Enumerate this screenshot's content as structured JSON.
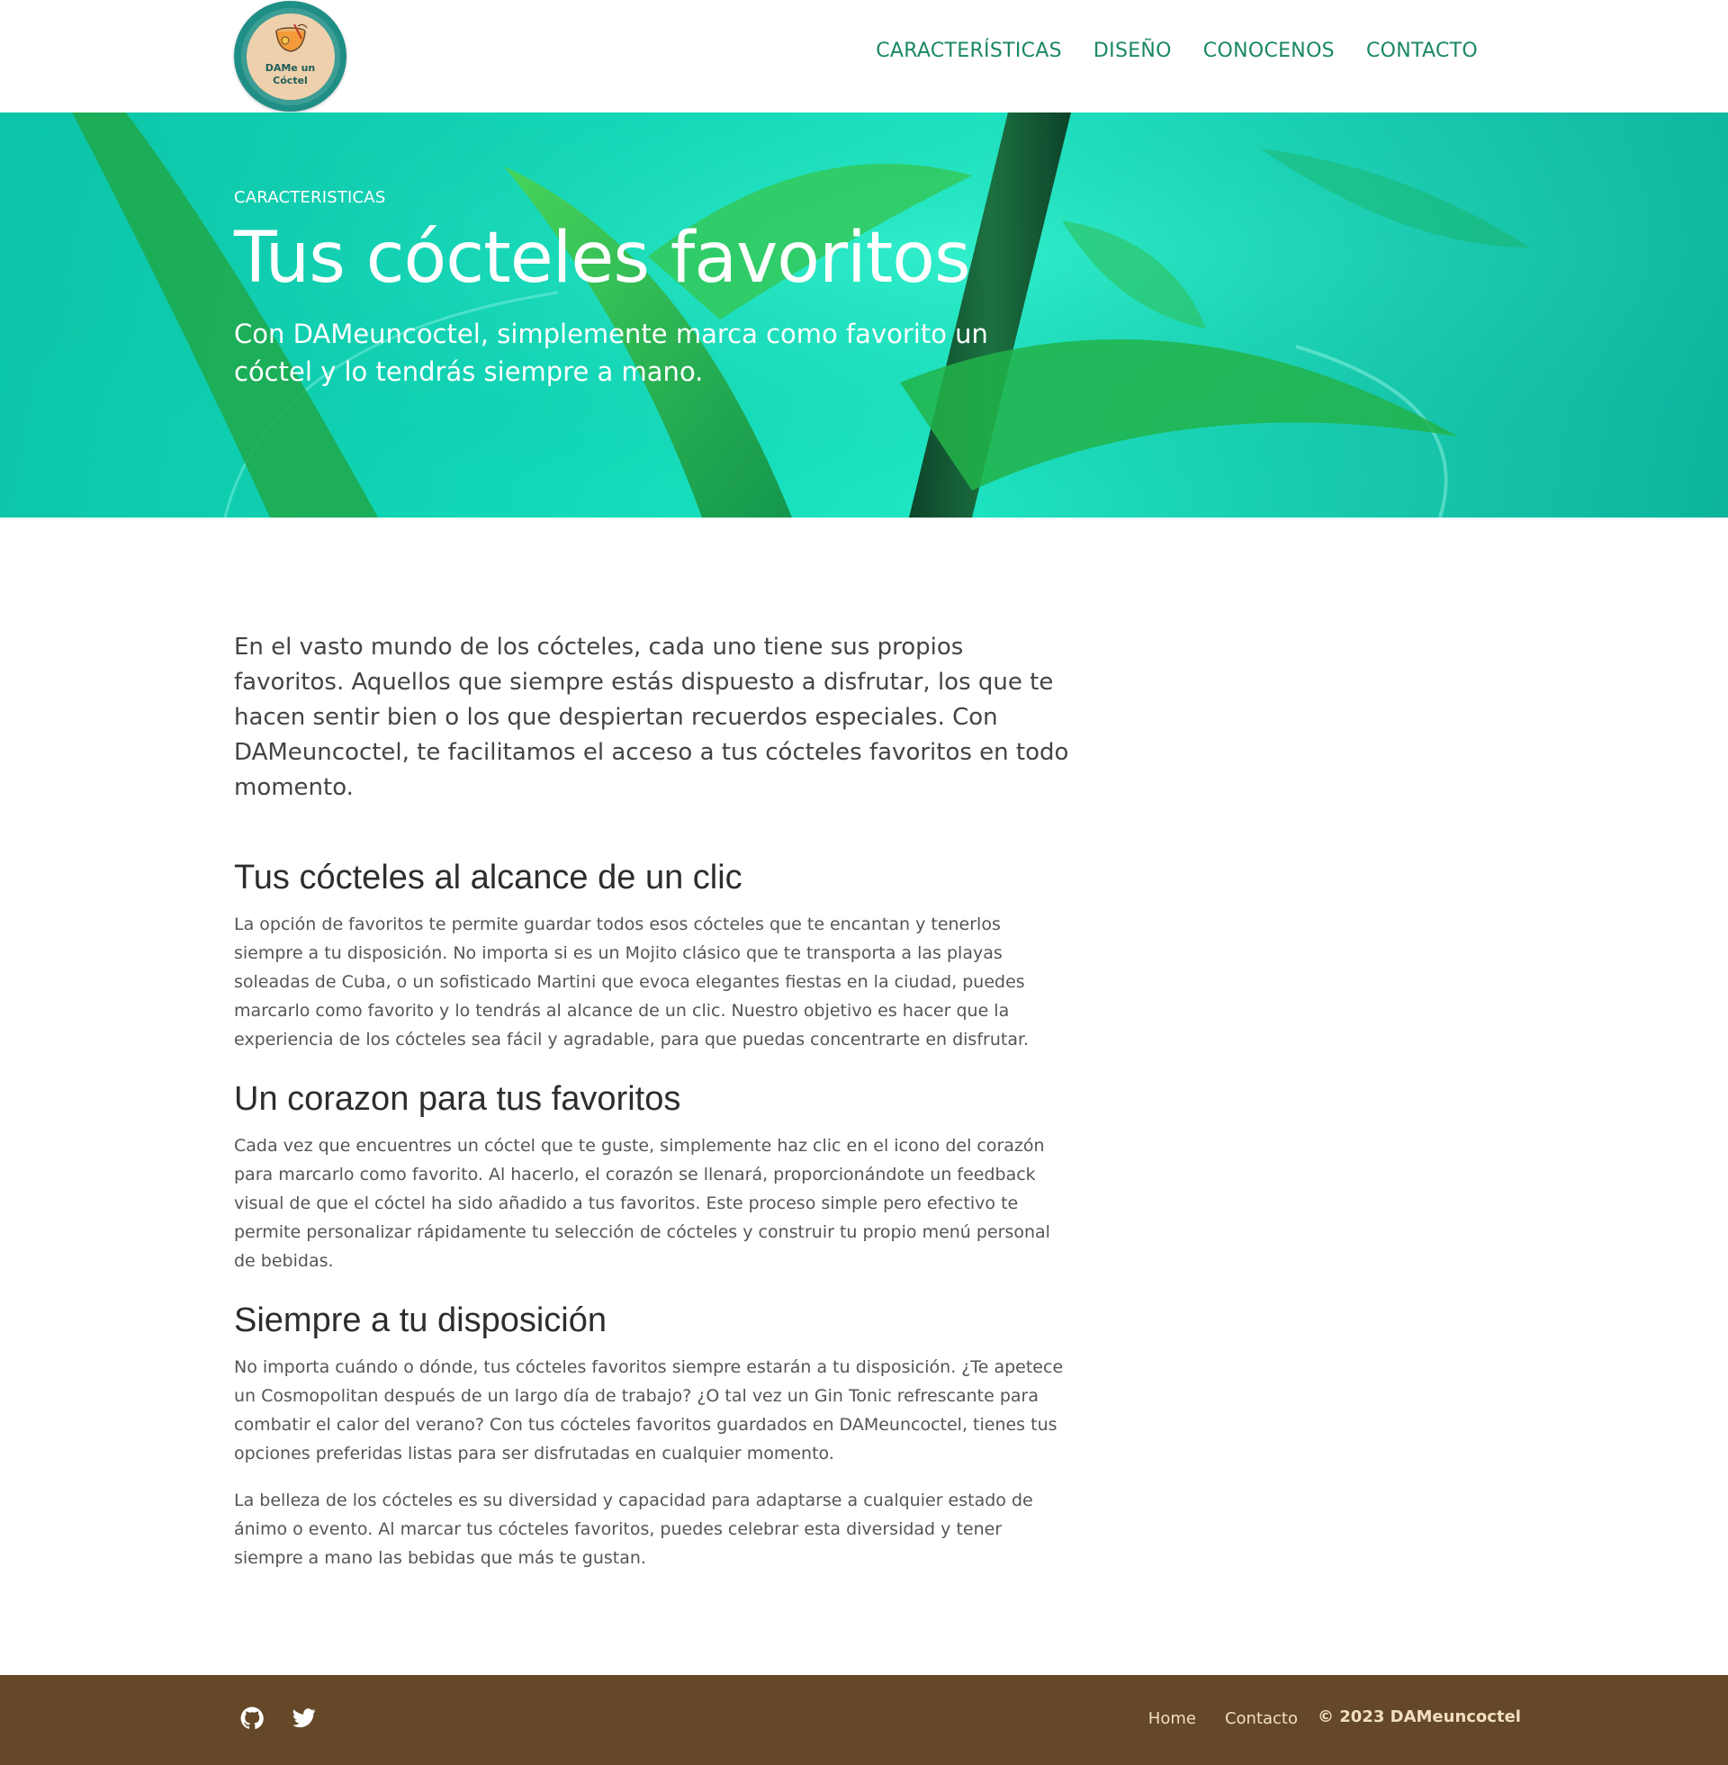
{
  "header": {
    "logo_text": "DAMe un Cóctel",
    "nav": [
      {
        "label": "CARACTERÍSTICAS"
      },
      {
        "label": "DISEÑO"
      },
      {
        "label": "CONOCENOS"
      },
      {
        "label": "CONTACTO"
      }
    ]
  },
  "hero": {
    "kicker": "CARACTERISTICAS",
    "title": "Tus cócteles favoritos",
    "subtitle": "Con DAMeuncoctel, simplemente marca como favorito un cóctel y lo tendrás siempre a mano."
  },
  "article": {
    "lead": "En el vasto mundo de los cócteles, cada uno tiene sus propios favoritos. Aquellos que siempre estás dispuesto a disfrutar, los que te hacen sentir bien o los que despiertan recuerdos especiales. Con DAMeuncoctel, te facilitamos el acceso a tus cócteles favoritos en todo momento.",
    "sections": [
      {
        "title": "Tus cócteles al alcance de un clic",
        "paragraphs": [
          "La opción de favoritos te permite guardar todos esos cócteles que te encantan y tenerlos siempre a tu disposición. No importa si es un Mojito clásico que te transporta a las playas soleadas de Cuba, o un sofisticado Martini que evoca elegantes fiestas en la ciudad, puedes marcarlo como favorito y lo tendrás al alcance de un clic. Nuestro objetivo es hacer que la experiencia de los cócteles sea fácil y agradable, para que puedas concentrarte en disfrutar."
        ]
      },
      {
        "title": "Un corazon para tus favoritos",
        "paragraphs": [
          "Cada vez que encuentres un cóctel que te guste, simplemente haz clic en el icono del corazón para marcarlo como favorito. Al hacerlo, el corazón se llenará, proporcionándote un feedback visual de que el cóctel ha sido añadido a tus favoritos. Este proceso simple pero efectivo te permite personalizar rápidamente tu selección de cócteles y construir tu propio menú personal de bebidas."
        ]
      },
      {
        "title": "Siempre a tu disposición",
        "paragraphs": [
          "No importa cuándo o dónde, tus cócteles favoritos siempre estarán a tu disposición. ¿Te apetece un Cosmopolitan después de un largo día de trabajo? ¿O tal vez un Gin Tonic refrescante para combatir el calor del verano? Con tus cócteles favoritos guardados en DAMeuncoctel, tienes tus opciones preferidas listas para ser disfrutadas en cualquier momento.",
          "La belleza de los cócteles es su diversidad y capacidad para adaptarse a cualquier estado de ánimo o evento. Al marcar tus cócteles favoritos, puedes celebrar esta diversidad y tener siempre a mano las bebidas que más te gustan."
        ]
      }
    ]
  },
  "footer": {
    "social": [
      {
        "icon": "github-icon"
      },
      {
        "icon": "twitter-icon"
      }
    ],
    "links": [
      {
        "label": "Home"
      },
      {
        "label": "Contacto"
      }
    ],
    "copyright": "© 2023 DAMeuncoctel"
  },
  "colors": {
    "nav_text": "#1a8766",
    "hero_bg": "#12d9b8",
    "footer_bg": "#644827",
    "footer_text": "#f1dfc3"
  }
}
